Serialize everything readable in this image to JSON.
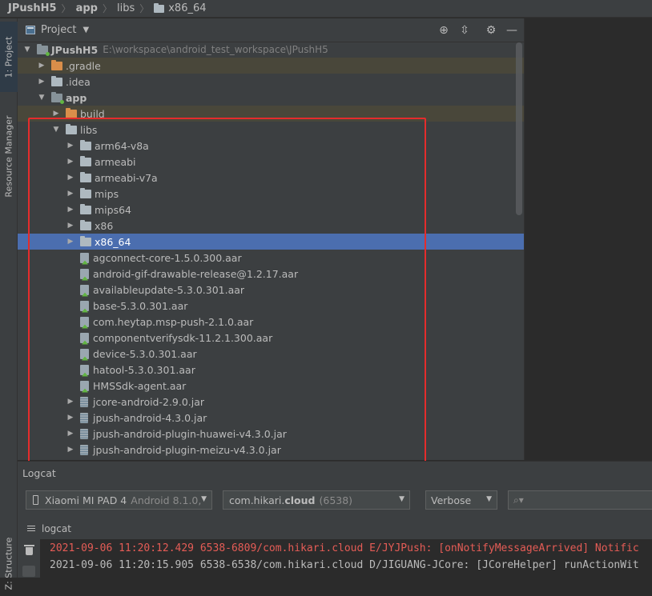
{
  "breadcrumb": {
    "items": [
      {
        "label": "JPushH5",
        "bold": true
      },
      {
        "label": "app",
        "bold": true
      },
      {
        "label": "libs",
        "bold": false
      },
      {
        "label": "x86_64",
        "bold": false
      }
    ]
  },
  "left_stripe": {
    "project_tab": "1: Project",
    "resource_tab": "Resource Manager",
    "structure_tab": "Z: Structure"
  },
  "project_panel": {
    "title": "Project",
    "tree": [
      {
        "label": "JPushH5",
        "path": "E:\\workspace\\android_test_workspace\\JPushH5",
        "depth": 0,
        "expanded": true,
        "icon": "module-folder-icon",
        "bold": true
      },
      {
        "label": ".gradle",
        "depth": 1,
        "expanded": false,
        "icon": "excluded-folder-icon",
        "excluded": true
      },
      {
        "label": ".idea",
        "depth": 1,
        "expanded": false,
        "icon": "folder-icon"
      },
      {
        "label": "app",
        "depth": 1,
        "expanded": true,
        "icon": "module-folder-icon",
        "bold": true
      },
      {
        "label": "build",
        "depth": 2,
        "expanded": false,
        "icon": "excluded-folder-icon",
        "excluded": true
      },
      {
        "label": "libs",
        "depth": 2,
        "expanded": true,
        "icon": "folder-icon"
      },
      {
        "label": "arm64-v8a",
        "depth": 3,
        "expanded": false,
        "icon": "folder-icon"
      },
      {
        "label": "armeabi",
        "depth": 3,
        "expanded": false,
        "icon": "folder-icon"
      },
      {
        "label": "armeabi-v7a",
        "depth": 3,
        "expanded": false,
        "icon": "folder-icon"
      },
      {
        "label": "mips",
        "depth": 3,
        "expanded": false,
        "icon": "folder-icon"
      },
      {
        "label": "mips64",
        "depth": 3,
        "expanded": false,
        "icon": "folder-icon"
      },
      {
        "label": "x86",
        "depth": 3,
        "expanded": false,
        "icon": "folder-icon"
      },
      {
        "label": "x86_64",
        "depth": 3,
        "expanded": false,
        "icon": "folder-icon",
        "selected": true
      },
      {
        "label": "agconnect-core-1.5.0.300.aar",
        "depth": 3,
        "icon": "aar-icon",
        "leaf": true
      },
      {
        "label": "android-gif-drawable-release@1.2.17.aar",
        "depth": 3,
        "icon": "aar-icon",
        "leaf": true
      },
      {
        "label": "availableupdate-5.3.0.301.aar",
        "depth": 3,
        "icon": "aar-icon",
        "leaf": true
      },
      {
        "label": "base-5.3.0.301.aar",
        "depth": 3,
        "icon": "aar-icon",
        "leaf": true
      },
      {
        "label": "com.heytap.msp-push-2.1.0.aar",
        "depth": 3,
        "icon": "aar-icon",
        "leaf": true
      },
      {
        "label": "componentverifysdk-11.2.1.300.aar",
        "depth": 3,
        "icon": "aar-icon",
        "leaf": true
      },
      {
        "label": "device-5.3.0.301.aar",
        "depth": 3,
        "icon": "aar-icon",
        "leaf": true
      },
      {
        "label": "hatool-5.3.0.301.aar",
        "depth": 3,
        "icon": "aar-icon",
        "leaf": true
      },
      {
        "label": "HMSSdk-agent.aar",
        "depth": 3,
        "icon": "aar-icon",
        "leaf": true
      },
      {
        "label": "jcore-android-2.9.0.jar",
        "depth": 3,
        "expanded": false,
        "icon": "jar-icon"
      },
      {
        "label": "jpush-android-4.3.0.jar",
        "depth": 3,
        "expanded": false,
        "icon": "jar-icon"
      },
      {
        "label": "jpush-android-plugin-huawei-v4.3.0.jar",
        "depth": 3,
        "expanded": false,
        "icon": "jar-icon"
      },
      {
        "label": "jpush-android-plugin-meizu-v4.3.0.jar",
        "depth": 3,
        "expanded": false,
        "icon": "jar-icon"
      }
    ]
  },
  "logcat": {
    "title": "Logcat",
    "device": {
      "name": "Xiaomi MI PAD 4",
      "detail": "Android 8.1.0,"
    },
    "process": {
      "prefix": "com.hikari.",
      "bold": "cloud",
      "pid": "(6538)"
    },
    "level": "Verbose",
    "search_placeholder": "",
    "subtab": "logcat",
    "lines": [
      "2021-09-06 11:20:12.429 6538-6809/com.hikari.cloud E/JYJPush: [onNotifyMessageArrived] Notific",
      "2021-09-06 11:20:15.905 6538-6538/com.hikari.cloud D/JIGUANG-JCore: [JCoreHelper] runActionWit"
    ]
  },
  "colors": {
    "selection": "#4b6eaf",
    "annotation": "#e52c2c",
    "error_log": "#e55c56"
  }
}
